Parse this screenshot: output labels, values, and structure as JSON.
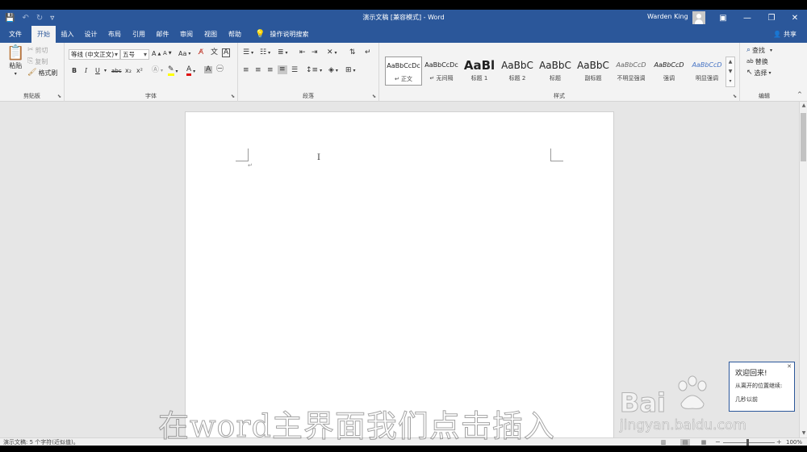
{
  "window": {
    "title": "演示文稿 [兼容模式] - Word",
    "user_name": "Warden King"
  },
  "tabs": [
    "文件",
    "开始",
    "插入",
    "设计",
    "布局",
    "引用",
    "邮件",
    "审阅",
    "视图",
    "帮助"
  ],
  "active_tab": "开始",
  "tell_me": "操作说明搜索",
  "share": "共享",
  "ribbon": {
    "clipboard": {
      "label": "剪贴板",
      "paste": "粘贴",
      "cut": "剪切",
      "copy": "复制",
      "format_painter": "格式刷"
    },
    "font": {
      "label": "字体",
      "font_name": "等线 (中文正文)",
      "font_size": "五号",
      "grow": "A",
      "shrink": "A",
      "case": "Aa",
      "bold": "B",
      "italic": "I",
      "underline": "U",
      "strike": "abc",
      "subscript": "x₂",
      "superscript": "x²"
    },
    "paragraph": {
      "label": "段落"
    },
    "styles": {
      "label": "样式",
      "items": [
        {
          "sample": "AaBbCcDc",
          "name": "↵ 正文"
        },
        {
          "sample": "AaBbCcDc",
          "name": "↵ 无间隔"
        },
        {
          "sample": "AaBl",
          "name": "标题 1"
        },
        {
          "sample": "AaBbC",
          "name": "标题 2"
        },
        {
          "sample": "AaBbC",
          "name": "标题"
        },
        {
          "sample": "AaBbC",
          "name": "副标题"
        },
        {
          "sample": "AaBbCcD",
          "name": "不明显强调"
        },
        {
          "sample": "AaBbCcD",
          "name": "强调"
        },
        {
          "sample": "AaBbCcD",
          "name": "明显强调"
        }
      ]
    },
    "editing": {
      "label": "编辑",
      "find": "查找",
      "replace": "替换",
      "select": "选择"
    }
  },
  "welcome_panel": {
    "title": "欢迎回来!",
    "subtitle": "从离开的位置继续:",
    "extra": "几秒以前"
  },
  "overlay": {
    "subtitle": "在word主界面我们点击插入",
    "watermark_logo": "Bai",
    "watermark_url": "jingyan.baidu.com"
  },
  "status": {
    "text": "演示文稿: 5 个字符(近似值)。",
    "zoom": "100%"
  },
  "colors": {
    "accent": "#2b579a",
    "ribbon_bg": "#f3f3f3",
    "canvas": "#e6e6e6"
  }
}
